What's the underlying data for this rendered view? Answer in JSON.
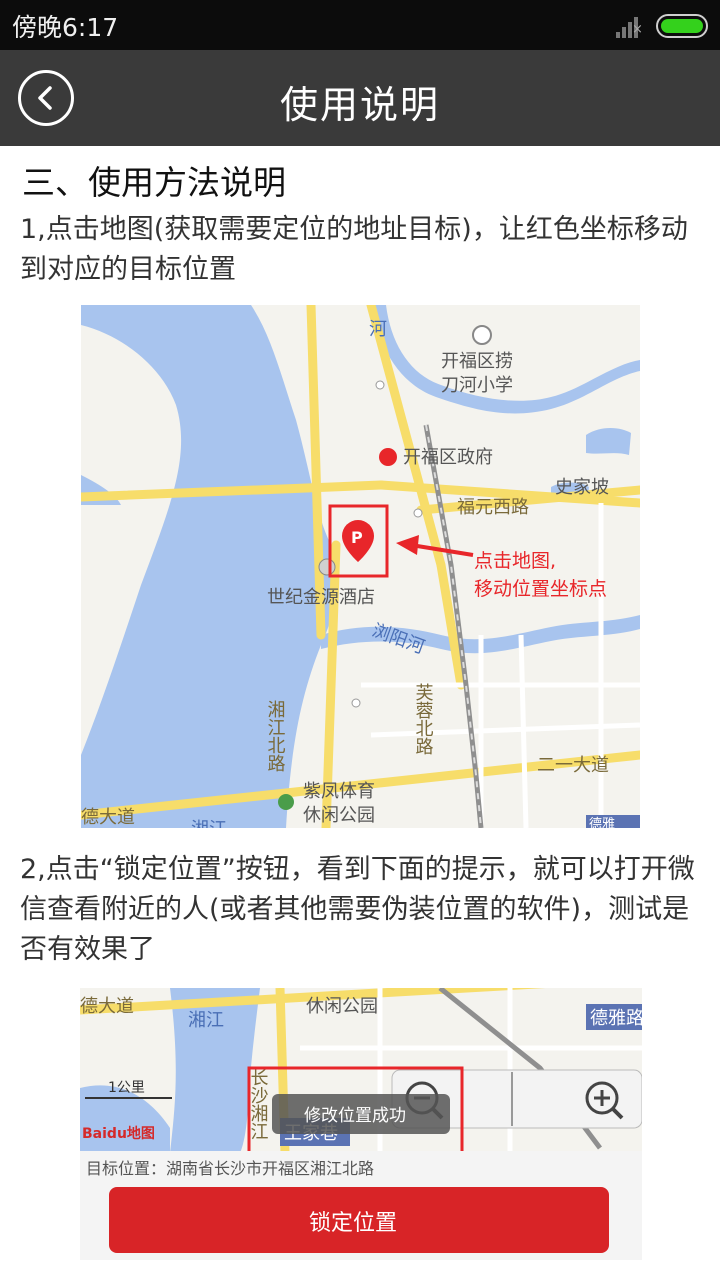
{
  "status_bar": {
    "time": "傍晚6:17",
    "signal_icon": "signal-icon",
    "battery_icon": "battery-icon"
  },
  "header": {
    "title": "使用说明",
    "back_icon": "back-icon"
  },
  "content": {
    "heading": "三、使用方法说明",
    "step1": "1,点击地图(获取需要定位的地址目标)，让红色坐标移动到对应的目标位置",
    "step2": "2,点击“锁定位置”按钮，看到下面的提示，就可以打开微信查看附近的人(或者其他需要伪装位置的软件)，测试是否有效果了"
  },
  "map1": {
    "labels": {
      "kaifu_school_1": "开福区捞",
      "kaifu_school_2": "刀河小学",
      "river_top": "河",
      "govt": "开福区政府",
      "fuyuan_rd": "福元西路",
      "shijiapo": "史家坡",
      "hotel": "世纪金源酒店",
      "liuyang_river": "浏阳河",
      "xiangjiang_n": "湘江北路",
      "furong_n": "芙蓉北路",
      "park_1": "紫凤体育",
      "park_2": "休闲公园",
      "second_ring": "二一大道",
      "avenue_left": "德大道",
      "xiang_bottom": "湘江",
      "deya": "德雅"
    },
    "annotation_1": "点击地图,",
    "annotation_2": "移动位置坐标点",
    "marker_letter": "P"
  },
  "map2": {
    "labels": {
      "avenue_left": "德大道",
      "park": "休闲公园",
      "xiangjiang": "湘江",
      "deya": "德雅路",
      "changsha": "长沙湘江",
      "wangjiaxiang": "王家巷",
      "scale": "1公里",
      "baidu": "Baidu地图"
    },
    "toast": "修改位置成功",
    "target_address": "目标位置：湖南省长沙市开福区湘江北路",
    "lock_button": "锁定位置",
    "zoom_out_icon": "zoom-out-icon",
    "zoom_in_icon": "zoom-in-icon"
  },
  "colors": {
    "status_bar": "#0c0c0c",
    "title_bar": "#3a3a3a",
    "map_bg": "#f4f3ee",
    "water": "#a8c4ee",
    "road": "#f7dd6a",
    "annotation_red": "#e8262a",
    "button_red": "#d82427"
  }
}
